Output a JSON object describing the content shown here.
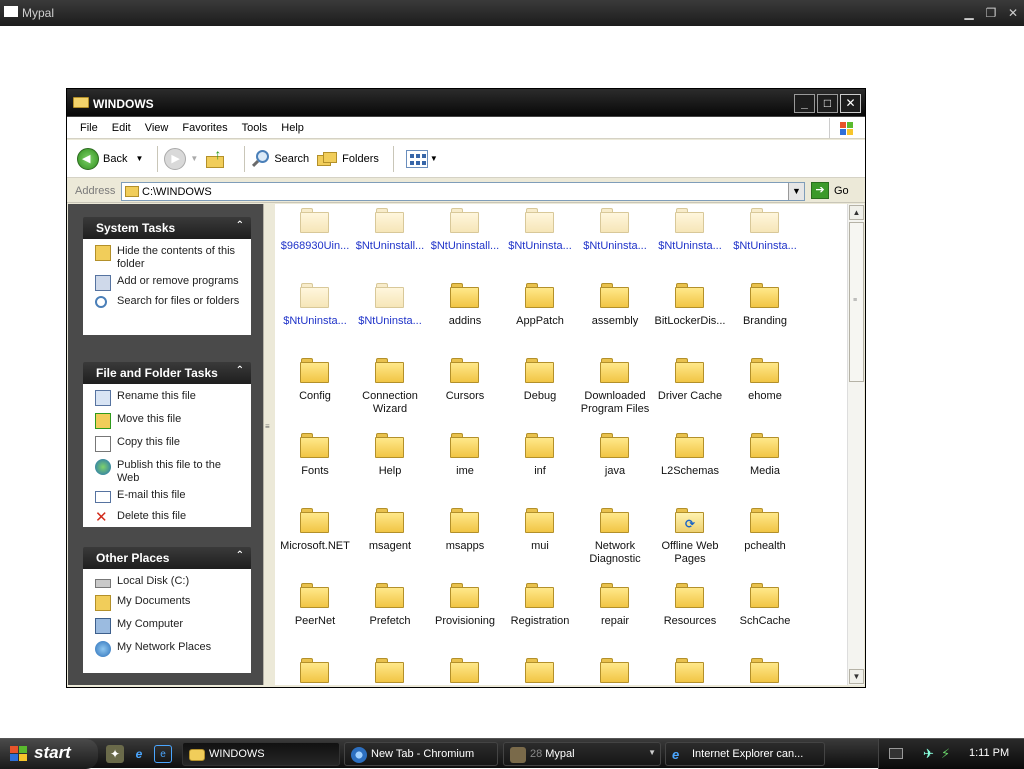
{
  "outer_window": {
    "title": "Mypal",
    "controls": [
      "minimize",
      "restore",
      "close"
    ]
  },
  "explorer": {
    "title": "WINDOWS",
    "menu": [
      "File",
      "Edit",
      "View",
      "Favorites",
      "Tools",
      "Help"
    ],
    "toolbar": {
      "back_label": "Back",
      "search_label": "Search",
      "folders_label": "Folders"
    },
    "address": {
      "label": "Address",
      "value": "C:\\WINDOWS",
      "go_label": "Go"
    },
    "task_panels": [
      {
        "title": "System Tasks",
        "items": [
          {
            "label": "Hide the contents of this folder",
            "icon": "hide-folder-icon"
          },
          {
            "label": "Add or remove programs",
            "icon": "add-remove-programs-icon"
          },
          {
            "label": "Search for files or folders",
            "icon": "search-icon"
          }
        ]
      },
      {
        "title": "File and Folder Tasks",
        "items": [
          {
            "label": "Rename this file",
            "icon": "rename-icon"
          },
          {
            "label": "Move this file",
            "icon": "move-icon"
          },
          {
            "label": "Copy this file",
            "icon": "copy-icon"
          },
          {
            "label": "Publish this file to the Web",
            "icon": "publish-web-icon"
          },
          {
            "label": "E-mail this file",
            "icon": "email-icon"
          },
          {
            "label": "Delete this file",
            "icon": "delete-icon"
          }
        ]
      },
      {
        "title": "Other Places",
        "items": [
          {
            "label": "Local Disk (C:)",
            "icon": "local-disk-icon"
          },
          {
            "label": "My Documents",
            "icon": "my-documents-icon"
          },
          {
            "label": "My Computer",
            "icon": "my-computer-icon"
          },
          {
            "label": "My Network Places",
            "icon": "network-places-icon"
          }
        ]
      }
    ],
    "files": [
      {
        "name": "$968930Uin...",
        "hidden": true
      },
      {
        "name": "$NtUninstall...",
        "hidden": true
      },
      {
        "name": "$NtUninstall...",
        "hidden": true
      },
      {
        "name": "$NtUninsta...",
        "hidden": true
      },
      {
        "name": "$NtUninsta...",
        "hidden": true
      },
      {
        "name": "$NtUninsta...",
        "hidden": true
      },
      {
        "name": "$NtUninsta...",
        "hidden": true
      },
      {
        "name": "$NtUninsta...",
        "hidden": true
      },
      {
        "name": "$NtUninsta...",
        "hidden": true
      },
      {
        "name": "addins"
      },
      {
        "name": "AppPatch"
      },
      {
        "name": "assembly"
      },
      {
        "name": "BitLockerDis..."
      },
      {
        "name": "Branding"
      },
      {
        "name": "Config"
      },
      {
        "name": "Connection Wizard"
      },
      {
        "name": "Cursors"
      },
      {
        "name": "Debug"
      },
      {
        "name": "Downloaded Program Files"
      },
      {
        "name": "Driver Cache"
      },
      {
        "name": "ehome"
      },
      {
        "name": "Fonts"
      },
      {
        "name": "Help"
      },
      {
        "name": "ime"
      },
      {
        "name": "inf"
      },
      {
        "name": "java"
      },
      {
        "name": "L2Schemas"
      },
      {
        "name": "Media"
      },
      {
        "name": "Microsoft.NET"
      },
      {
        "name": "msagent"
      },
      {
        "name": "msapps"
      },
      {
        "name": "mui"
      },
      {
        "name": "Network Diagnostic"
      },
      {
        "name": "Offline Web Pages",
        "special": true
      },
      {
        "name": "pchealth"
      },
      {
        "name": "PeerNet"
      },
      {
        "name": "Prefetch"
      },
      {
        "name": "Provisioning"
      },
      {
        "name": "Registration"
      },
      {
        "name": "repair"
      },
      {
        "name": "Resources"
      },
      {
        "name": "SchCache"
      },
      {
        "name": ""
      },
      {
        "name": ""
      },
      {
        "name": ""
      },
      {
        "name": ""
      },
      {
        "name": ""
      },
      {
        "name": ""
      },
      {
        "name": ""
      }
    ]
  },
  "taskbar": {
    "start_label": "start",
    "quick_launch": [
      "winamp-icon",
      "ie-icon",
      "ie-alt-icon"
    ],
    "buttons": [
      {
        "label": "WINDOWS",
        "icon": "folder-icon",
        "active": true
      },
      {
        "label": "New Tab - Chromium",
        "icon": "chromium-icon"
      },
      {
        "count": "28",
        "label": "Mypal",
        "icon": "mypal-icon",
        "group": true
      },
      {
        "label": "Internet Explorer can...",
        "icon": "ie-icon"
      }
    ],
    "clock": "1:11 PM"
  }
}
